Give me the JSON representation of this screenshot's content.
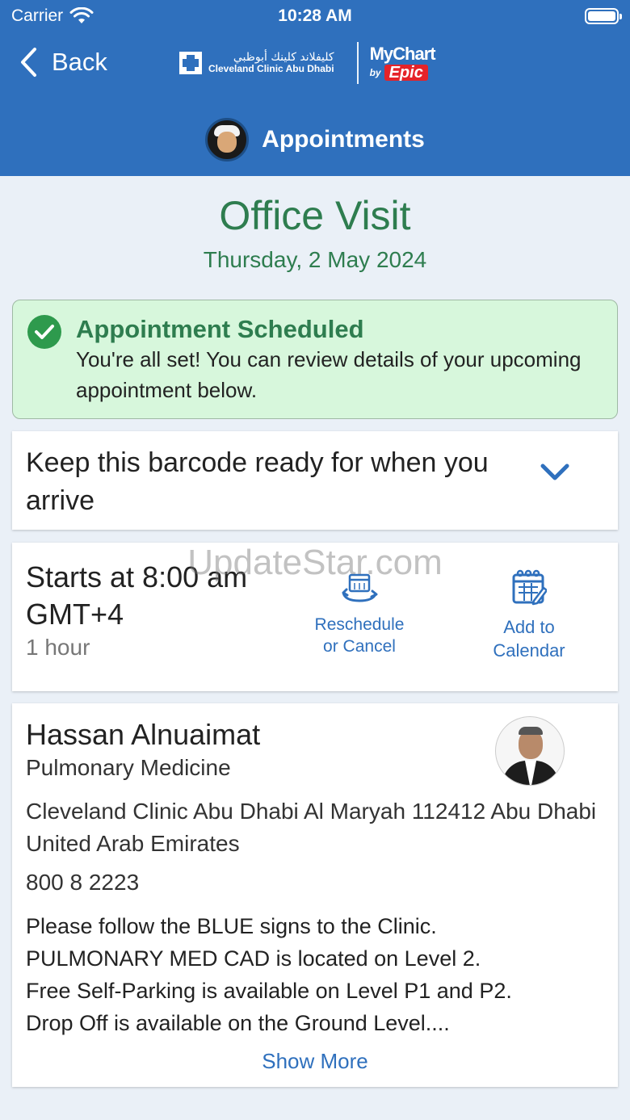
{
  "status_bar": {
    "carrier": "Carrier",
    "time": "10:28 AM"
  },
  "nav": {
    "back_label": "Back",
    "logo_arabic": "كليفلاند كلينك أبوظبي",
    "logo_english": "Cleveland Clinic Abu Dhabi",
    "mychart": "MyChart",
    "by": "by",
    "epic": "Epic",
    "page_title": "Appointments"
  },
  "visit": {
    "title": "Office Visit",
    "date": "Thursday, 2 May 2024"
  },
  "banner": {
    "title": "Appointment Scheduled",
    "body": "You're all set! You can review details of your upcoming appointment below."
  },
  "barcode": {
    "text": "Keep this barcode ready for when you arrive"
  },
  "time": {
    "starts_line1": "Starts at 8:00 am",
    "starts_line2": "GMT+4",
    "duration": "1 hour",
    "reschedule_line1": "Reschedule",
    "reschedule_line2": "or Cancel",
    "calendar_line1": "Add to",
    "calendar_line2": "Calendar"
  },
  "provider": {
    "name": "Hassan Alnuaimat",
    "specialty": "Pulmonary Medicine",
    "address": "Cleveland Clinic Abu Dhabi Al Maryah 112412 Abu Dhabi United Arab Emirates",
    "phone": "800 8 2223",
    "notes_line1": "Please follow the BLUE signs to the Clinic.",
    "notes_line2": "PULMONARY MED CAD is located on Level 2.",
    "notes_line3": "Free Self-Parking is available on Level P1 and P2.",
    "notes_line4": "Drop Off is available on the Ground Level....",
    "show_more": "Show More"
  },
  "watermark": "UpdateStar.com",
  "colors": {
    "header_blue": "#2f70bd",
    "success_green": "#2e7d4f",
    "banner_bg": "#d7f7dc",
    "link_blue": "#2f70bd"
  }
}
